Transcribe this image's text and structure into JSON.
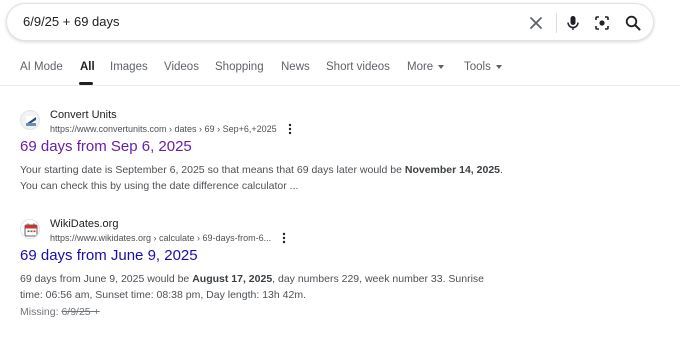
{
  "search": {
    "query": "6/9/25 + 69 days"
  },
  "tabs": [
    {
      "label": "AI Mode"
    },
    {
      "label": "All"
    },
    {
      "label": "Images"
    },
    {
      "label": "Videos"
    },
    {
      "label": "Shopping"
    },
    {
      "label": "News"
    },
    {
      "label": "Short videos"
    },
    {
      "label": "More"
    },
    {
      "label": "Tools"
    }
  ],
  "results": [
    {
      "site_name": "Convert Units",
      "url": "https://www.convertunits.com › dates › 69 › Sep+6,+2025",
      "title": "69 days from Sep 6, 2025",
      "snippet_line1_a": "Your starting date is September 6, 2025 so that means that 69 days later would be ",
      "snippet_line1_bold": "November 14, 2025",
      "snippet_line1_b": ".",
      "snippet_line2": "You can check this by using the date difference calculator ..."
    },
    {
      "site_name": "WikiDates.org",
      "url": "https://www.wikidates.org › calculate › 69-days-from-6...",
      "title": "69 days from June 9, 2025",
      "snippet_line1_a": "69 days from June 9, 2025 would be ",
      "snippet_line1_bold": "August 17, 2025",
      "snippet_line1_b": ", day numbers 229, week number 33. Sunrise",
      "snippet_line2": "time: 06:56 am, Sunset time: 08:38 pm, Day length: 13h 42m.",
      "missing_label": "Missing: ",
      "missing_term": "6/9/25 +"
    }
  ],
  "colors": {
    "link": "#1a0dab",
    "visited": "#681da8",
    "snippet": "#4d5156"
  }
}
